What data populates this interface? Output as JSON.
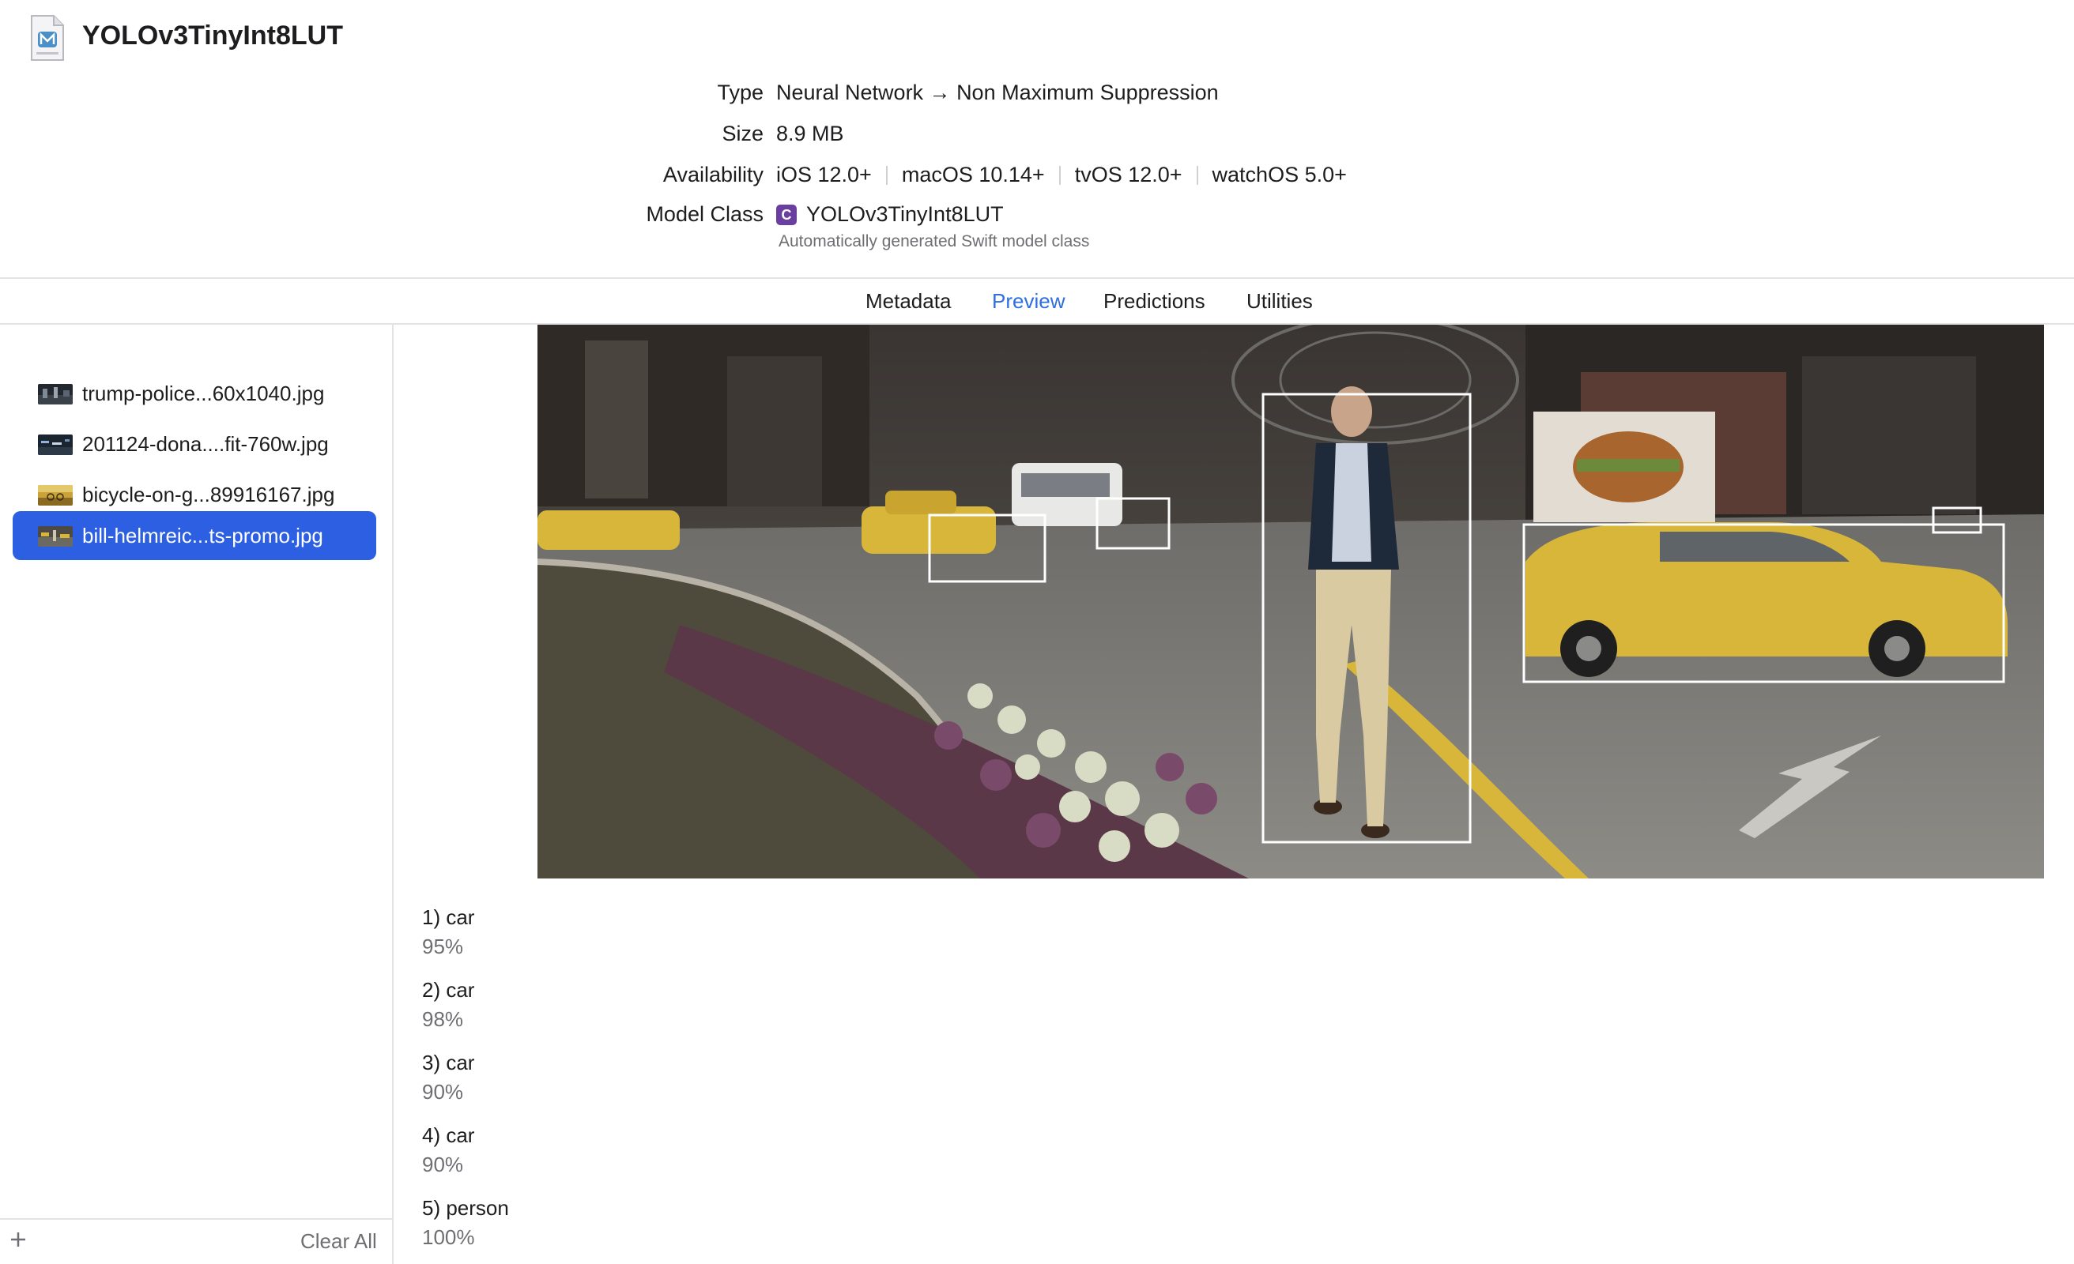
{
  "header": {
    "title": "YOLOv3TinyInt8LUT",
    "file_icon": "mlmodel-file-icon"
  },
  "info": {
    "type_label": "Type",
    "type_value": "Neural Network → Non Maximum Suppression",
    "size_label": "Size",
    "size_value": "8.9 MB",
    "availability_label": "Availability",
    "availability": [
      "iOS 12.0+",
      "macOS 10.14+",
      "tvOS 12.0+",
      "watchOS 5.0+"
    ],
    "model_class_label": "Model Class",
    "model_class_badge": "C",
    "model_class_value": "YOLOv3TinyInt8LUT",
    "model_class_sub": "Automatically generated Swift model class"
  },
  "tabs": {
    "items": [
      "Metadata",
      "Preview",
      "Predictions",
      "Utilities"
    ],
    "active": "Preview",
    "active_color": "#2e6fe0"
  },
  "sidebar": {
    "files": [
      {
        "name": "trump-police...60x1040.jpg",
        "selected": false
      },
      {
        "name": "201124-dona....fit-760w.jpg",
        "selected": false
      },
      {
        "name": "bicycle-on-g...89916167.jpg",
        "selected": false
      },
      {
        "name": "bill-helmreic...ts-promo.jpg",
        "selected": true
      }
    ],
    "selected_color": "#2d5fe3",
    "add_icon": "plus-icon",
    "clear_all_label": "Clear All"
  },
  "predictions": [
    {
      "label": "1) car",
      "confidence": "95%"
    },
    {
      "label": "2) car",
      "confidence": "98%"
    },
    {
      "label": "3) car",
      "confidence": "90%"
    },
    {
      "label": "4) car",
      "confidence": "90%"
    },
    {
      "label": "5) person",
      "confidence": "100%"
    }
  ]
}
